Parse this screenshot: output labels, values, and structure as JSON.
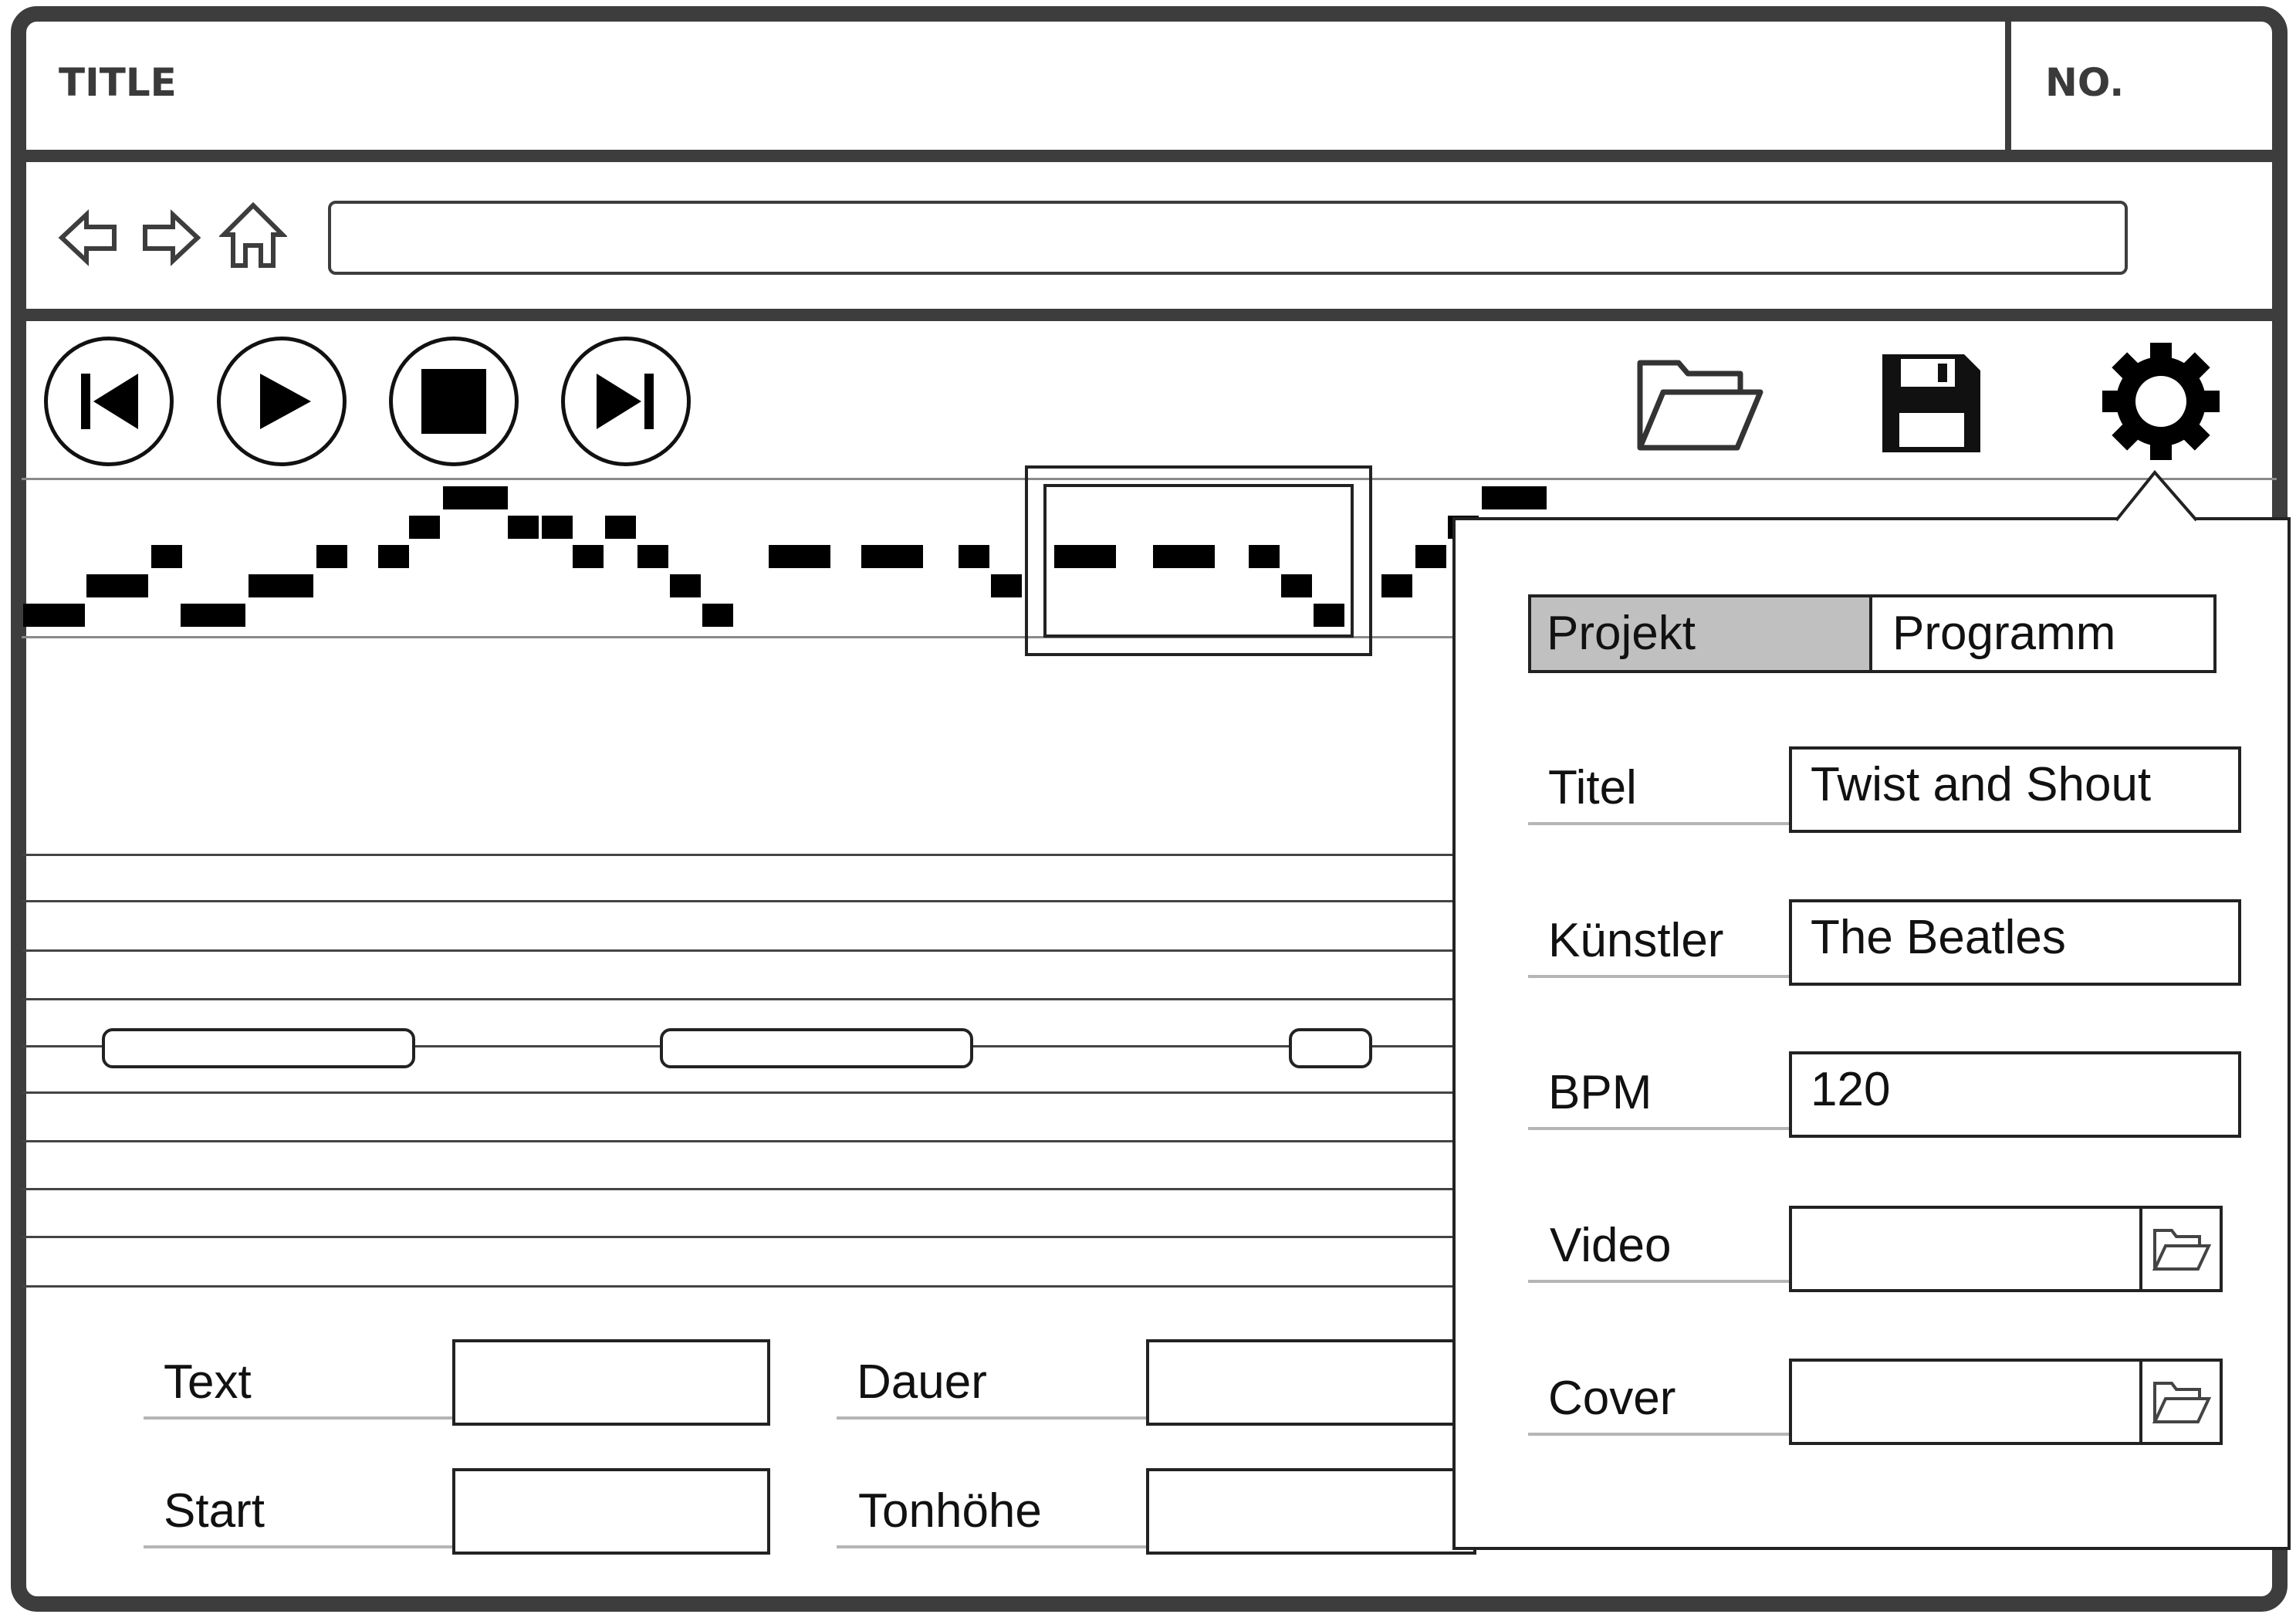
{
  "window": {
    "title": "TITLE",
    "number": "NO."
  },
  "nav": {
    "back_icon": "arrow-left-icon",
    "forward_icon": "arrow-right-icon",
    "home_icon": "home-icon",
    "address_value": ""
  },
  "toolbar": {
    "icons": [
      "skip-back-icon",
      "play-icon",
      "stop-icon",
      "skip-forward-icon",
      "folder-open-icon",
      "save-icon",
      "gear-icon"
    ]
  },
  "editor": {
    "fields": {
      "text_label": "Text",
      "text_value": "",
      "start_label": "Start",
      "start_value": "",
      "duration_label": "Dauer",
      "duration_value": "",
      "pitch_label": "Tonhöhe",
      "pitch_value": ""
    }
  },
  "settings": {
    "tabs": [
      {
        "label": "Projekt",
        "active": true
      },
      {
        "label": "Programm",
        "active": false
      }
    ],
    "title_label": "Titel",
    "title_value": "Twist and Shout",
    "artist_label": "Künstler",
    "artist_value": "The Beatles",
    "bpm_label": "BPM",
    "bpm_value": "120",
    "video_label": "Video",
    "video_value": "",
    "cover_label": "Cover",
    "cover_value": ""
  },
  "colors": {
    "frame": "#3d3d3d",
    "active_tab": "#c0c0c0",
    "background": "#ffffff"
  }
}
